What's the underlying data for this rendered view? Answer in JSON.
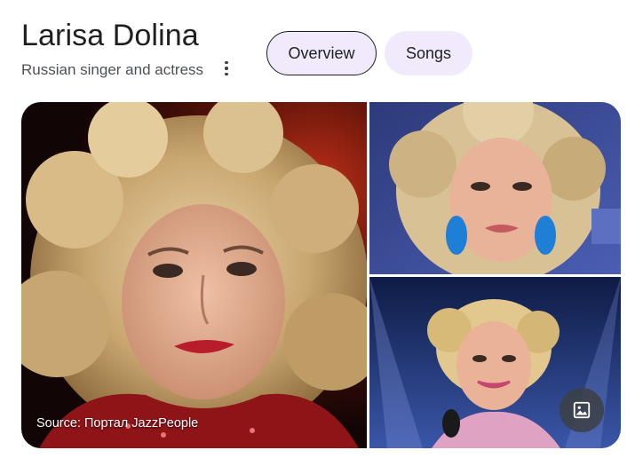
{
  "header": {
    "title": "Larisa Dolina",
    "subtitle": "Russian singer and actress",
    "more_icon": "more-vert-icon"
  },
  "tabs": [
    {
      "label": "Overview",
      "selected": true
    },
    {
      "label": "Songs",
      "selected": false
    }
  ],
  "gallery": {
    "source_caption": "Source: Портал JazzPeople",
    "images_button_icon": "image-icon"
  },
  "colors": {
    "chip_background": "#f1eafc",
    "title_text": "#1f1f1f",
    "subtitle_text": "#4d5156"
  }
}
